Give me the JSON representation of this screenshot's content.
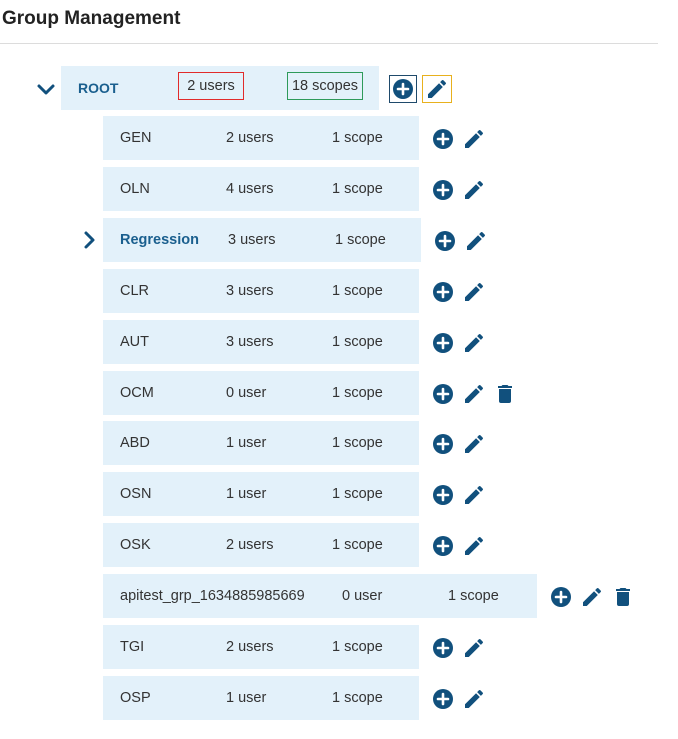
{
  "page": {
    "title": "Group Management"
  },
  "root": {
    "name": "ROOT",
    "users": "2 users",
    "scopes": "18 scopes"
  },
  "groups": [
    {
      "name": "GEN",
      "users": "2 users",
      "scopes": "1 scope"
    },
    {
      "name": "OLN",
      "users": "4 users",
      "scopes": "1 scope"
    },
    {
      "name": "Regression",
      "users": "3 users",
      "scopes": "1 scope"
    },
    {
      "name": "CLR",
      "users": "3 users",
      "scopes": "1 scope"
    },
    {
      "name": "AUT",
      "users": "3 users",
      "scopes": "1 scope"
    },
    {
      "name": "OCM",
      "users": "0 user",
      "scopes": "1 scope"
    },
    {
      "name": "ABD",
      "users": "1 user",
      "scopes": "1 scope"
    },
    {
      "name": "OSN",
      "users": "1 user",
      "scopes": "1 scope"
    },
    {
      "name": "OSK",
      "users": "2 users",
      "scopes": "1 scope"
    },
    {
      "name": "apitest_grp_1634885985669",
      "users": "0 user",
      "scopes": "1 scope"
    },
    {
      "name": "TGI",
      "users": "2 users",
      "scopes": "1 scope"
    },
    {
      "name": "OSP",
      "users": "1 user",
      "scopes": "1 scope"
    }
  ],
  "colors": {
    "accent": "#1a5f8e",
    "row_bg": "#e3f1fa",
    "icon": "#11507d"
  },
  "icons": {
    "add": "plus-circle-icon",
    "edit": "pencil-icon",
    "delete": "trash-icon",
    "expand": "chevron-icon"
  }
}
